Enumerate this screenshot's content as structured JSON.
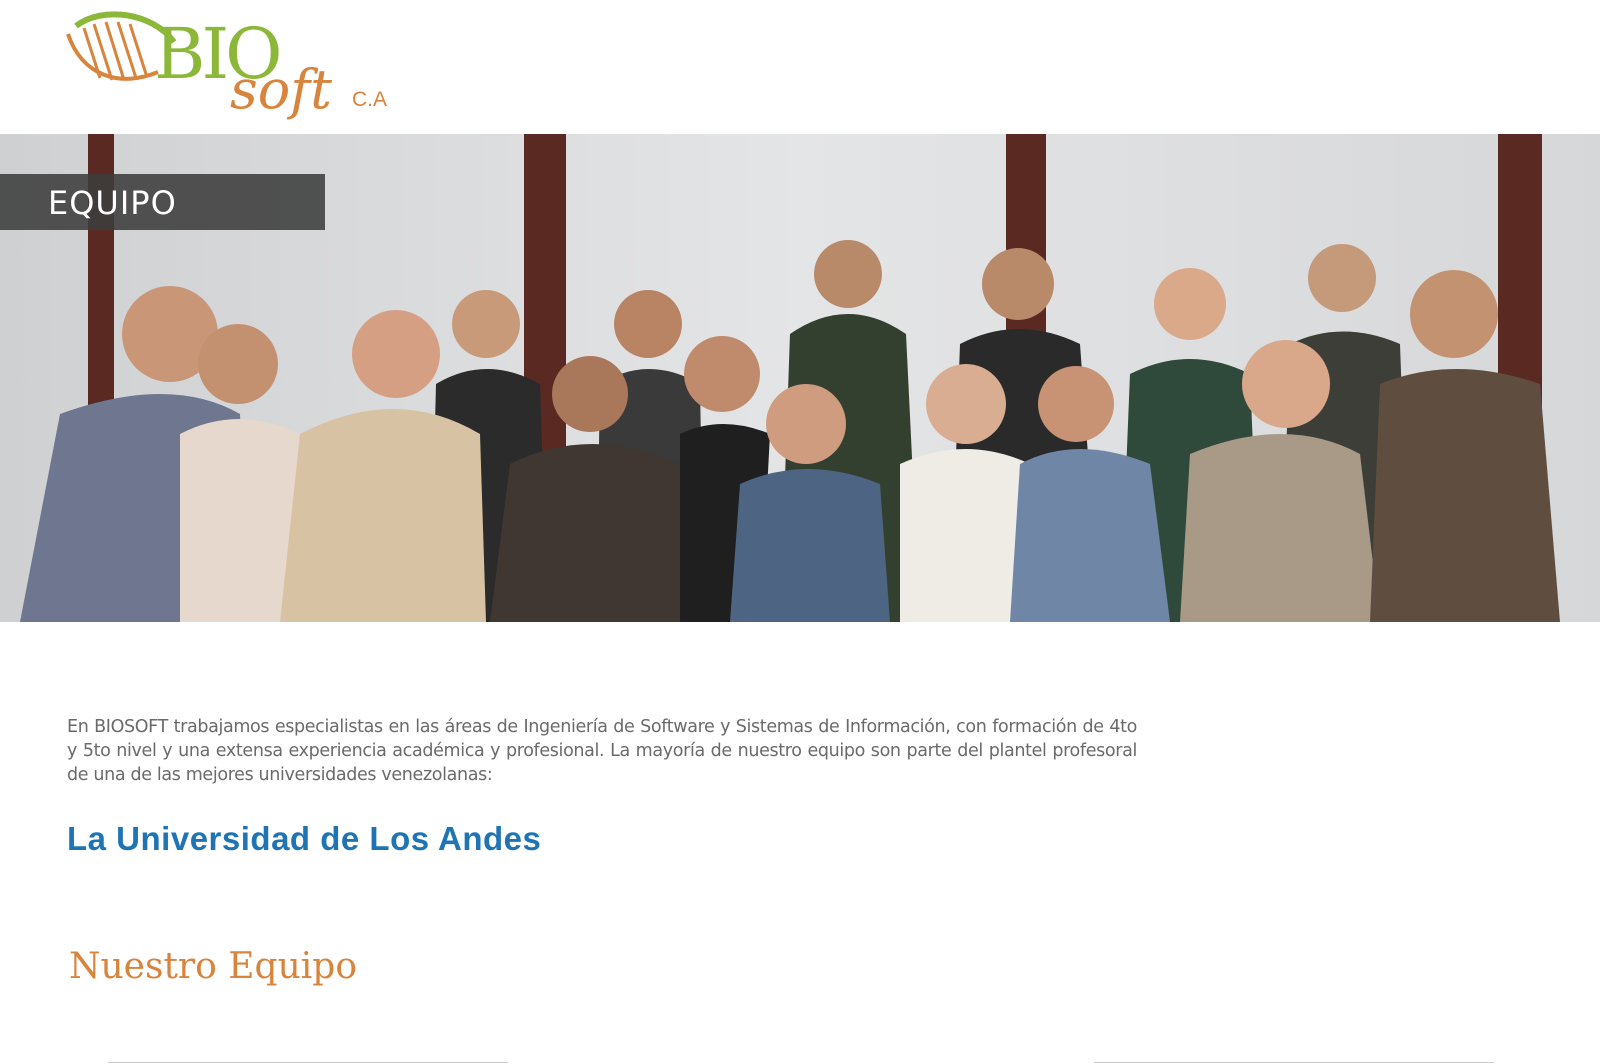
{
  "header": {
    "logo": {
      "text": "BIO soft C.A",
      "bio": "BIO",
      "soft": "soft",
      "suffix": "C.A"
    }
  },
  "hero": {
    "banner_label": "EQUIPO",
    "image": "team-photo"
  },
  "content": {
    "intro": "En BIOSOFT trabajamos especialistas en las áreas de Ingeniería de Software y Sistemas de Información, con formación de 4to y 5to nivel y una extensa experiencia académica y profesional. La mayoría de nuestro equipo son parte del plantel profesoral de una de las mejores universidades venezolanas:",
    "university": "La Universidad de Los Andes",
    "section_title": {
      "part1": "Nuestro ",
      "part2": "Equipo"
    }
  },
  "colors": {
    "logo_green": "#8cb83a",
    "logo_orange": "#d8843c",
    "banner_bg": "#3c3c3c",
    "university_blue": "#1f75b3",
    "section_orange": "#d8843c",
    "body_text": "#6a6a6a"
  }
}
